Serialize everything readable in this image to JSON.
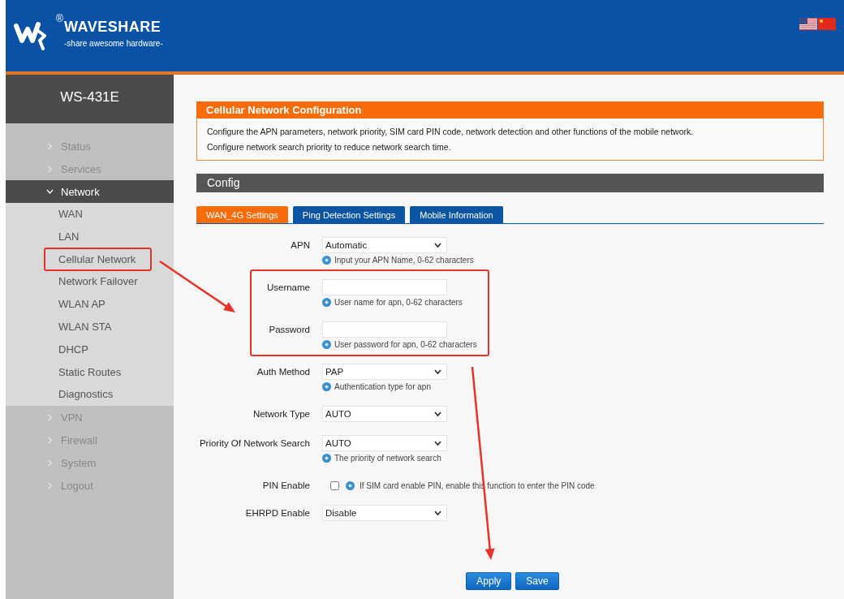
{
  "header": {
    "brand": "WAVESHARE",
    "registered_mark": "®",
    "tagline": "-share awesome hardware-"
  },
  "sidebar": {
    "title": "WS-431E",
    "items": [
      {
        "label": "Status",
        "expanded": false
      },
      {
        "label": "Services",
        "expanded": false
      },
      {
        "label": "Network",
        "expanded": true,
        "children": [
          {
            "label": "WAN"
          },
          {
            "label": "LAN"
          },
          {
            "label": "Cellular Network"
          },
          {
            "label": "Network Failover"
          },
          {
            "label": "WLAN AP"
          },
          {
            "label": "WLAN STA"
          },
          {
            "label": "DHCP"
          },
          {
            "label": "Static Routes"
          },
          {
            "label": "Diagnostics"
          }
        ]
      },
      {
        "label": "VPN",
        "expanded": false
      },
      {
        "label": "Firewall",
        "expanded": false
      },
      {
        "label": "System",
        "expanded": false
      },
      {
        "label": "Logout",
        "expanded": false
      }
    ]
  },
  "intro": {
    "title": "Cellular Network Configuration",
    "lines": [
      "Configure the APN parameters, network priority, SIM card PIN code, network detection and other functions of the mobile network.",
      "Configure network search priority to reduce network search time."
    ]
  },
  "section": {
    "title": "Config"
  },
  "tabs": [
    {
      "label": "WAN_4G Settings",
      "selected": true
    },
    {
      "label": "Ping Detection Settings",
      "selected": false
    },
    {
      "label": "Mobile Information",
      "selected": false
    }
  ],
  "form": [
    {
      "kind": "select",
      "label": "APN",
      "value": "Automatic",
      "hint": "Input your APN Name, 0-62 characters"
    },
    {
      "kind": "text",
      "label": "Username",
      "hint": "User name for apn, 0-62 characters"
    },
    {
      "kind": "text",
      "label": "Password",
      "hint": "User password for apn, 0-62 characters"
    },
    {
      "kind": "select",
      "label": "Auth Method",
      "value": "PAP",
      "hint": "Authentication type for apn"
    },
    {
      "kind": "select",
      "label": "Network Type",
      "value": "AUTO"
    },
    {
      "kind": "select",
      "label": "Priority Of Network Search",
      "value": "AUTO",
      "hint": "The priority of network search"
    },
    {
      "kind": "checkbox",
      "label": "PIN Enable",
      "checked": false,
      "hint": "If SIM card enable PIN, enable this function to enter the PIN code"
    },
    {
      "kind": "select",
      "label": "EHRPD Enable",
      "value": "Disable"
    }
  ],
  "buttons": [
    "Apply",
    "Save"
  ],
  "annotations": [
    {
      "kind": "box"
    },
    {
      "kind": "box"
    },
    {
      "kind": "arrow"
    },
    {
      "kind": "arrow"
    }
  ]
}
